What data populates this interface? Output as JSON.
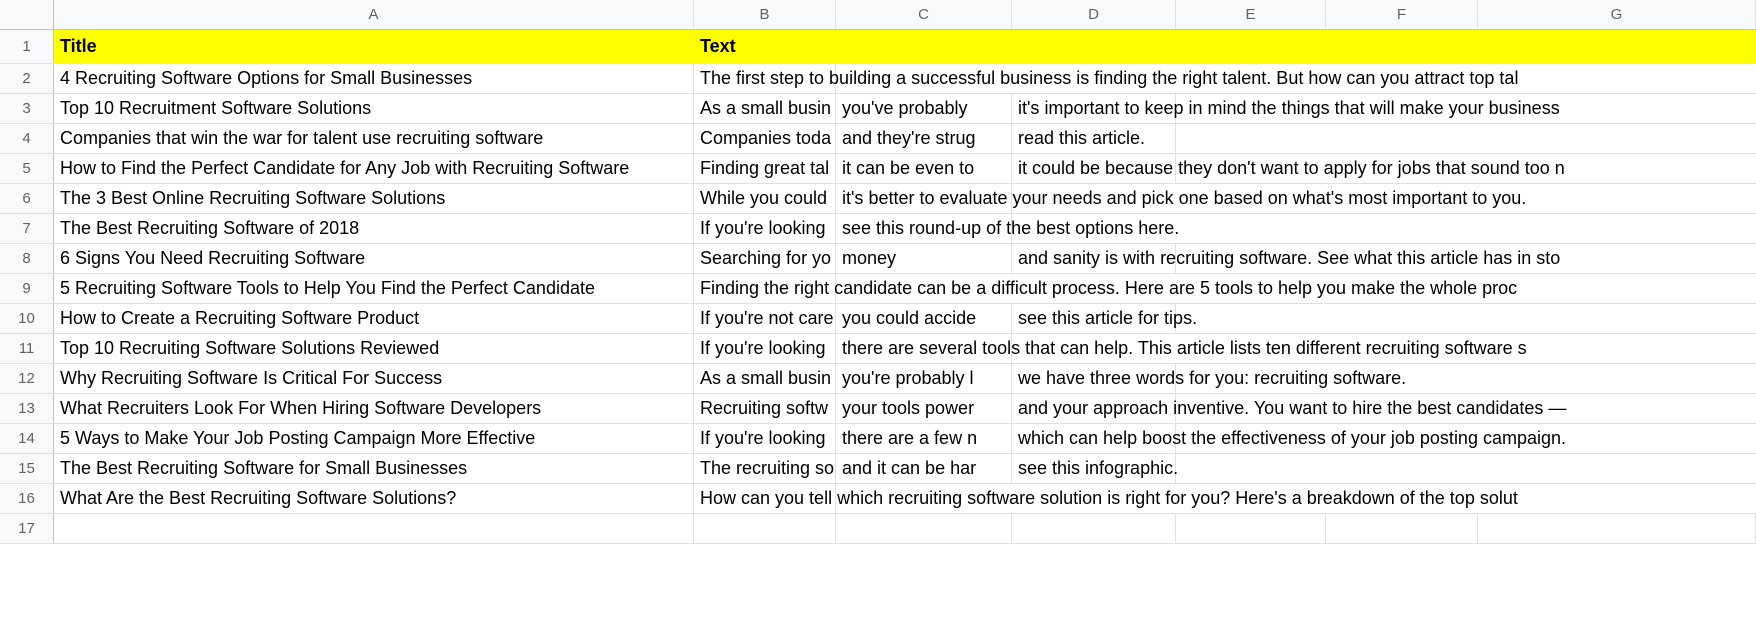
{
  "columns": [
    "A",
    "B",
    "C",
    "D",
    "E",
    "F",
    "G"
  ],
  "headerRow": {
    "A": "Title",
    "B": "Text"
  },
  "rows": [
    {
      "num": 1,
      "isHeader": true,
      "cells": {
        "A": "Title",
        "B": "Text",
        "C": "",
        "D": "",
        "E": "",
        "F": "",
        "G": ""
      }
    },
    {
      "num": 2,
      "cells": {
        "A": "4 Recruiting Software Options for Small Businesses",
        "B": "The first step to building a successful business is finding the right talent. But how can you attract top tal",
        "overflow": true
      }
    },
    {
      "num": 3,
      "cells": {
        "A": "Top 10 Recruitment Software Solutions",
        "B": "As a small busin",
        "C": "you've probably ",
        "D": "it's important to keep in mind the things that will make your business",
        "overflowD": true
      }
    },
    {
      "num": 4,
      "cells": {
        "A": "Companies that win the war for talent use recruiting software",
        "B": "Companies toda",
        "C": "and they're strug",
        "D": "read this article.",
        "overflowD": true
      }
    },
    {
      "num": 5,
      "cells": {
        "A": "How to Find the Perfect Candidate for Any Job with Recruiting Software",
        "B": "Finding great tal",
        "C": "it can be even to",
        "D": "it could be because they don't want to apply for jobs that sound too n",
        "overflowD": true
      }
    },
    {
      "num": 6,
      "cells": {
        "A": "The 3 Best Online Recruiting Software Solutions",
        "B": "While you could ",
        "C": "it's better to evaluate your needs and pick one based on what's most important to you.",
        "overflowC": true
      }
    },
    {
      "num": 7,
      "cells": {
        "A": "The Best Recruiting Software of 2018",
        "B": "If you're looking ",
        "C": "see this round-up of the best options here.",
        "overflowC": true
      }
    },
    {
      "num": 8,
      "cells": {
        "A": "6 Signs You Need Recruiting Software",
        "B": "Searching for yo",
        "C": "money",
        "D": "and sanity is with recruiting software. See what this article has in sto",
        "overflowD": true
      }
    },
    {
      "num": 9,
      "cells": {
        "A": "5 Recruiting Software Tools to Help You Find the Perfect Candidate",
        "B": "Finding the right candidate can be a difficult process. Here are 5 tools to help you make the whole proc",
        "overflow": true
      }
    },
    {
      "num": 10,
      "cells": {
        "A": "How to Create a Recruiting Software Product",
        "B": "If you're not care",
        "C": "you could accide",
        "D": "see this article for tips.",
        "overflowD": true
      }
    },
    {
      "num": 11,
      "cells": {
        "A": "Top 10 Recruiting Software Solutions Reviewed",
        "B": "If you're looking ",
        "C": "there are several tools that can help. This article lists ten different recruiting software s",
        "overflowC": true
      }
    },
    {
      "num": 12,
      "cells": {
        "A": "Why Recruiting Software Is Critical For Success",
        "B": "As a small busin",
        "C": "you're probably l",
        "D": "we have three words for you: recruiting software.",
        "overflowD": true
      }
    },
    {
      "num": 13,
      "cells": {
        "A": "What Recruiters Look For When Hiring Software Developers",
        "B": "Recruiting softw",
        "C": "your tools power",
        "D": "and your approach inventive. You want to hire the best candidates —",
        "overflowD": true
      }
    },
    {
      "num": 14,
      "cells": {
        "A": "5 Ways to Make Your Job Posting Campaign More Effective",
        "B": "If you're looking ",
        "C": "there are a few n",
        "D": "which can help boost the effectiveness of your job posting campaign.",
        "overflowD": true
      }
    },
    {
      "num": 15,
      "cells": {
        "A": "The Best Recruiting Software for Small Businesses",
        "B": "The recruiting so",
        "C": "and it can be har",
        "D": "see this infographic.",
        "overflowD": true
      }
    },
    {
      "num": 16,
      "cells": {
        "A": "What Are the Best Recruiting Software Solutions?",
        "B": "How can you tell which recruiting software solution is right for you? Here's a breakdown of the top solut",
        "overflow": true
      }
    },
    {
      "num": 17,
      "cells": {
        "A": "",
        "B": "",
        "C": "",
        "D": "",
        "E": "",
        "F": "",
        "G": ""
      }
    }
  ]
}
